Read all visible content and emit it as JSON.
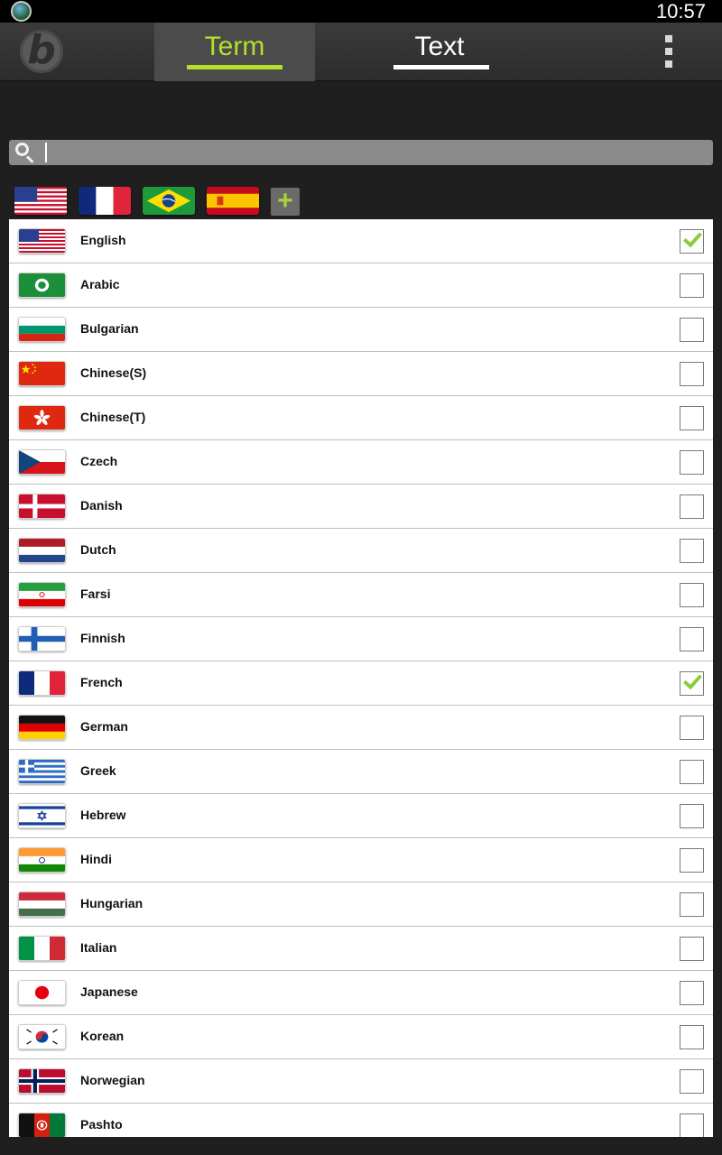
{
  "status_bar": {
    "time": "10:57"
  },
  "action_bar": {
    "tabs": [
      {
        "label": "Term",
        "selected": true
      },
      {
        "label": "Text",
        "selected": false
      }
    ]
  },
  "search": {
    "value": "",
    "placeholder": ""
  },
  "quick_flags": [
    "us-flag-icon",
    "france-flag-icon",
    "brazil-flag-icon",
    "spain-flag-icon"
  ],
  "languages": [
    {
      "name": "English",
      "checked": true
    },
    {
      "name": "Arabic",
      "checked": false
    },
    {
      "name": "Bulgarian",
      "checked": false
    },
    {
      "name": "Chinese(S)",
      "checked": false
    },
    {
      "name": "Chinese(T)",
      "checked": false
    },
    {
      "name": "Czech",
      "checked": false
    },
    {
      "name": "Danish",
      "checked": false
    },
    {
      "name": "Dutch",
      "checked": false
    },
    {
      "name": "Farsi",
      "checked": false
    },
    {
      "name": "Finnish",
      "checked": false
    },
    {
      "name": "French",
      "checked": true
    },
    {
      "name": "German",
      "checked": false
    },
    {
      "name": "Greek",
      "checked": false
    },
    {
      "name": "Hebrew",
      "checked": false
    },
    {
      "name": "Hindi",
      "checked": false
    },
    {
      "name": "Hungarian",
      "checked": false
    },
    {
      "name": "Italian",
      "checked": false
    },
    {
      "name": "Japanese",
      "checked": false
    },
    {
      "name": "Korean",
      "checked": false
    },
    {
      "name": "Norwegian",
      "checked": false
    },
    {
      "name": "Pashto",
      "checked": false
    }
  ],
  "colors": {
    "accent": "#b4e02a",
    "check": "#8ccc3a",
    "action_bar": "#3b3b3b",
    "background": "#1f1f1f"
  }
}
